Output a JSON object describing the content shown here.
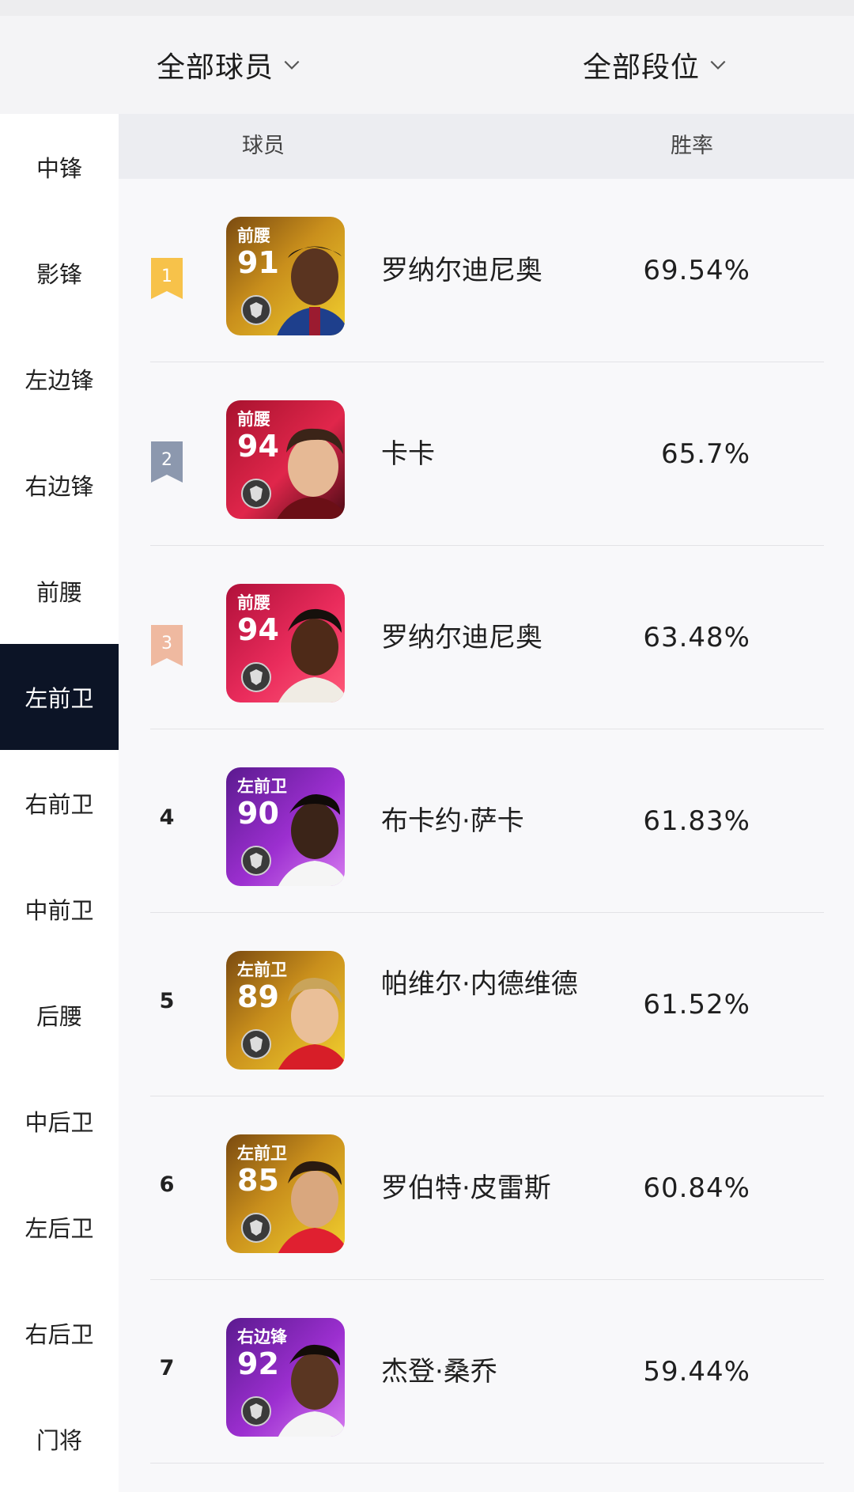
{
  "filters": {
    "players": "全部球员",
    "tiers": "全部段位"
  },
  "table_header": {
    "player": "球员",
    "win_rate": "胜率"
  },
  "sidebar": {
    "items": [
      {
        "label": "中锋",
        "active": false
      },
      {
        "label": "影锋",
        "active": false
      },
      {
        "label": "左边锋",
        "active": false
      },
      {
        "label": "右边锋",
        "active": false
      },
      {
        "label": "前腰",
        "active": false
      },
      {
        "label": "左前卫",
        "active": true
      },
      {
        "label": "右前卫",
        "active": false
      },
      {
        "label": "中前卫",
        "active": false
      },
      {
        "label": "后腰",
        "active": false
      },
      {
        "label": "中后卫",
        "active": false
      },
      {
        "label": "左后卫",
        "active": false
      },
      {
        "label": "右后卫",
        "active": false
      },
      {
        "label": "门将",
        "active": false
      }
    ]
  },
  "rows": [
    {
      "rank": "1",
      "position": "前腰",
      "rating": "91",
      "name": "罗纳尔迪尼奥",
      "win_rate": "69.54%",
      "card_color": "gold"
    },
    {
      "rank": "2",
      "position": "前腰",
      "rating": "94",
      "name": "卡卡",
      "win_rate": "65.7%",
      "card_color": "crimson"
    },
    {
      "rank": "3",
      "position": "前腰",
      "rating": "94",
      "name": "罗纳尔迪尼奥",
      "win_rate": "63.48%",
      "card_color": "crimson"
    },
    {
      "rank": "4",
      "position": "左前卫",
      "rating": "90",
      "name": "布卡约·萨卡",
      "win_rate": "61.83%",
      "card_color": "purple"
    },
    {
      "rank": "5",
      "position": "左前卫",
      "rating": "89",
      "name": "帕维尔·内德维德",
      "win_rate": "61.52%",
      "card_color": "gold"
    },
    {
      "rank": "6",
      "position": "左前卫",
      "rating": "85",
      "name": "罗伯特·皮雷斯",
      "win_rate": "60.84%",
      "card_color": "gold"
    },
    {
      "rank": "7",
      "position": "右边锋",
      "rating": "92",
      "name": "杰登·桑乔",
      "win_rate": "59.44%",
      "card_color": "purple"
    }
  ],
  "colors": {
    "active_sidebar": "#0c1426",
    "rank1": "#f7c24a",
    "rank2": "#8c98ae",
    "rank3": "#efb9a0"
  }
}
